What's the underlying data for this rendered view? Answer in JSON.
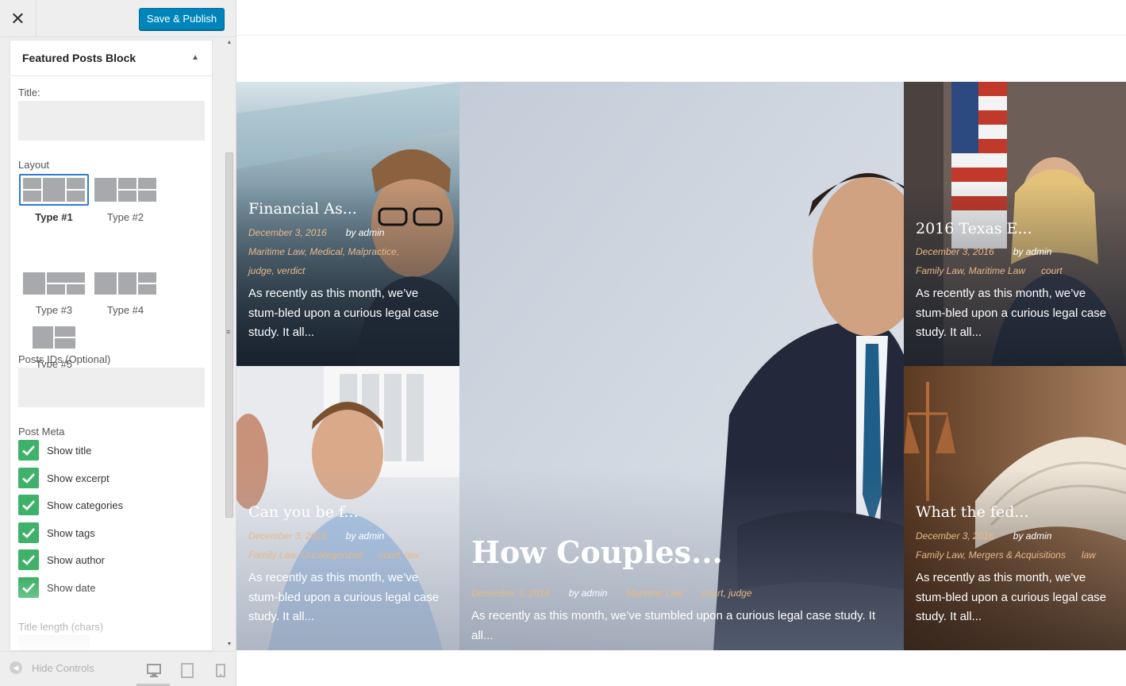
{
  "sidebar": {
    "close_icon": "close-icon",
    "save_label": "Save & Publish",
    "panel_title": "Featured Posts Block",
    "title_label": "Title:",
    "title_value": "",
    "layout_label": "Layout",
    "layouts": [
      {
        "label": "Type #1",
        "selected": true
      },
      {
        "label": "Type #2",
        "selected": false
      },
      {
        "label": "Type #3",
        "selected": false
      },
      {
        "label": "Type #4",
        "selected": false
      },
      {
        "label": "Type #5",
        "selected": false
      }
    ],
    "posts_ids_label": "Posts IDs (Optional)",
    "posts_ids_value": "",
    "post_meta_label": "Post Meta",
    "meta_options": [
      {
        "label": "Show title",
        "checked": true
      },
      {
        "label": "Show excerpt",
        "checked": true
      },
      {
        "label": "Show categories",
        "checked": true
      },
      {
        "label": "Show tags",
        "checked": true
      },
      {
        "label": "Show author",
        "checked": true
      },
      {
        "label": "Show date",
        "checked": true
      }
    ],
    "title_length_label": "Title length (chars)",
    "hide_controls_label": "Hide Controls",
    "devices": [
      "desktop-icon",
      "tablet-icon",
      "mobile-icon"
    ]
  },
  "colors": {
    "accent_button": "#0085ba",
    "checkbox": "#3fb26a",
    "meta_date": "#e8b889"
  },
  "posts": [
    {
      "title": "Financial As...",
      "date": "December 3, 2016",
      "author": "by admin",
      "categories": "Maritime Law, Medical, Malpractice,",
      "tags": "judge, verdict",
      "excerpt": "As recently as this month, we’ve stum-bled upon a curious legal case study. It all..."
    },
    {
      "title": "How Couples...",
      "date": "December 3, 2016",
      "author": "by admin",
      "categories": "Maritime Law",
      "tags": "court, judge",
      "excerpt": "As recently as this month, we’ve stumbled upon a curious legal case study. It all..."
    },
    {
      "title": "2016 Texas E...",
      "date": "December 3, 2016",
      "author": "by admin",
      "categories": "Family Law, Maritime Law",
      "tags": "court",
      "excerpt": "As recently as this month, we’ve stum-bled upon a curious legal case study. It all..."
    },
    {
      "title": "Can you be f...",
      "date": "December 3, 2016",
      "author": "by admin",
      "categories": "Family Law, Uncategorized",
      "tags": "court, law",
      "excerpt": "As recently as this month, we’ve stum-bled upon a curious legal case study. It all..."
    },
    {
      "title": "What the fed...",
      "date": "December 3, 2016",
      "author": "by admin",
      "categories": "Family Law, Mergers & Acquisitions",
      "tags": "law",
      "excerpt": "As recently as this month, we’ve stum-bled upon a curious legal case study. It all..."
    }
  ]
}
